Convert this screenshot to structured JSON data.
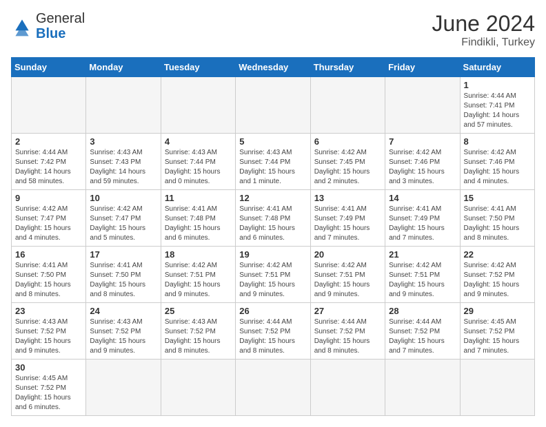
{
  "header": {
    "logo_general": "General",
    "logo_blue": "Blue",
    "month_year": "June 2024",
    "location": "Findikli, Turkey"
  },
  "days_of_week": [
    "Sunday",
    "Monday",
    "Tuesday",
    "Wednesday",
    "Thursday",
    "Friday",
    "Saturday"
  ],
  "weeks": [
    [
      null,
      null,
      null,
      null,
      null,
      null,
      {
        "day": "1",
        "sunrise": "4:44 AM",
        "sunset": "7:41 PM",
        "daylight": "14 hours and 57 minutes."
      }
    ],
    [
      {
        "day": "2",
        "sunrise": "4:44 AM",
        "sunset": "7:42 PM",
        "daylight": "14 hours and 58 minutes."
      },
      {
        "day": "3",
        "sunrise": "4:43 AM",
        "sunset": "7:43 PM",
        "daylight": "14 hours and 59 minutes."
      },
      {
        "day": "4",
        "sunrise": "4:43 AM",
        "sunset": "7:44 PM",
        "daylight": "15 hours and 0 minutes."
      },
      {
        "day": "5",
        "sunrise": "4:43 AM",
        "sunset": "7:44 PM",
        "daylight": "15 hours and 1 minute."
      },
      {
        "day": "6",
        "sunrise": "4:42 AM",
        "sunset": "7:45 PM",
        "daylight": "15 hours and 2 minutes."
      },
      {
        "day": "7",
        "sunrise": "4:42 AM",
        "sunset": "7:46 PM",
        "daylight": "15 hours and 3 minutes."
      },
      {
        "day": "8",
        "sunrise": "4:42 AM",
        "sunset": "7:46 PM",
        "daylight": "15 hours and 4 minutes."
      }
    ],
    [
      {
        "day": "9",
        "sunrise": "4:42 AM",
        "sunset": "7:47 PM",
        "daylight": "15 hours and 4 minutes."
      },
      {
        "day": "10",
        "sunrise": "4:42 AM",
        "sunset": "7:47 PM",
        "daylight": "15 hours and 5 minutes."
      },
      {
        "day": "11",
        "sunrise": "4:41 AM",
        "sunset": "7:48 PM",
        "daylight": "15 hours and 6 minutes."
      },
      {
        "day": "12",
        "sunrise": "4:41 AM",
        "sunset": "7:48 PM",
        "daylight": "15 hours and 6 minutes."
      },
      {
        "day": "13",
        "sunrise": "4:41 AM",
        "sunset": "7:49 PM",
        "daylight": "15 hours and 7 minutes."
      },
      {
        "day": "14",
        "sunrise": "4:41 AM",
        "sunset": "7:49 PM",
        "daylight": "15 hours and 7 minutes."
      },
      {
        "day": "15",
        "sunrise": "4:41 AM",
        "sunset": "7:50 PM",
        "daylight": "15 hours and 8 minutes."
      }
    ],
    [
      {
        "day": "16",
        "sunrise": "4:41 AM",
        "sunset": "7:50 PM",
        "daylight": "15 hours and 8 minutes."
      },
      {
        "day": "17",
        "sunrise": "4:41 AM",
        "sunset": "7:50 PM",
        "daylight": "15 hours and 8 minutes."
      },
      {
        "day": "18",
        "sunrise": "4:42 AM",
        "sunset": "7:51 PM",
        "daylight": "15 hours and 9 minutes."
      },
      {
        "day": "19",
        "sunrise": "4:42 AM",
        "sunset": "7:51 PM",
        "daylight": "15 hours and 9 minutes."
      },
      {
        "day": "20",
        "sunrise": "4:42 AM",
        "sunset": "7:51 PM",
        "daylight": "15 hours and 9 minutes."
      },
      {
        "day": "21",
        "sunrise": "4:42 AM",
        "sunset": "7:51 PM",
        "daylight": "15 hours and 9 minutes."
      },
      {
        "day": "22",
        "sunrise": "4:42 AM",
        "sunset": "7:52 PM",
        "daylight": "15 hours and 9 minutes."
      }
    ],
    [
      {
        "day": "23",
        "sunrise": "4:43 AM",
        "sunset": "7:52 PM",
        "daylight": "15 hours and 9 minutes."
      },
      {
        "day": "24",
        "sunrise": "4:43 AM",
        "sunset": "7:52 PM",
        "daylight": "15 hours and 9 minutes."
      },
      {
        "day": "25",
        "sunrise": "4:43 AM",
        "sunset": "7:52 PM",
        "daylight": "15 hours and 8 minutes."
      },
      {
        "day": "26",
        "sunrise": "4:44 AM",
        "sunset": "7:52 PM",
        "daylight": "15 hours and 8 minutes."
      },
      {
        "day": "27",
        "sunrise": "4:44 AM",
        "sunset": "7:52 PM",
        "daylight": "15 hours and 8 minutes."
      },
      {
        "day": "28",
        "sunrise": "4:44 AM",
        "sunset": "7:52 PM",
        "daylight": "15 hours and 7 minutes."
      },
      {
        "day": "29",
        "sunrise": "4:45 AM",
        "sunset": "7:52 PM",
        "daylight": "15 hours and 7 minutes."
      }
    ],
    [
      {
        "day": "30",
        "sunrise": "4:45 AM",
        "sunset": "7:52 PM",
        "daylight": "15 hours and 6 minutes."
      },
      null,
      null,
      null,
      null,
      null,
      null
    ]
  ]
}
